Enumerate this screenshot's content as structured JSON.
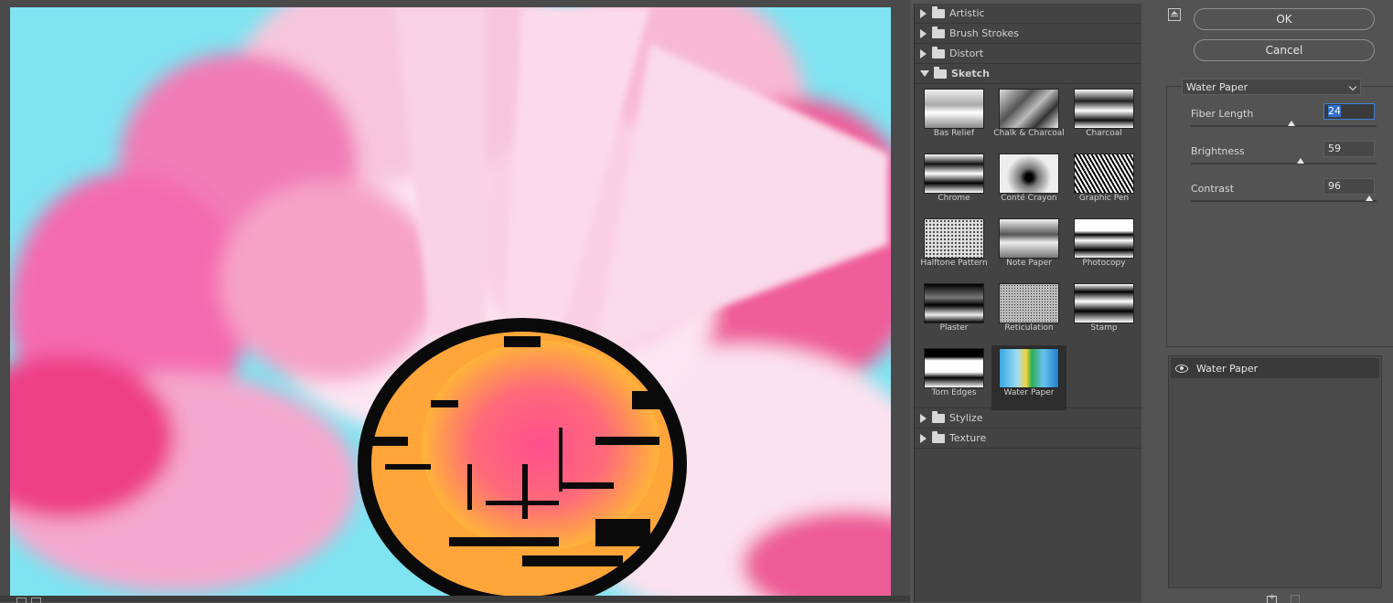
{
  "gallery": {
    "categories_top": [
      {
        "label": "Artistic",
        "expanded": false
      },
      {
        "label": "Brush Strokes",
        "expanded": false
      },
      {
        "label": "Distort",
        "expanded": false
      },
      {
        "label": "Sketch",
        "expanded": true
      }
    ],
    "sketch_filters": [
      "Bas Relief",
      "Chalk & Charcoal",
      "Charcoal",
      "Chrome",
      "Conté Crayon",
      "Graphic Pen",
      "Halftone Pattern",
      "Note Paper",
      "Photocopy",
      "Plaster",
      "Reticulation",
      "Stamp",
      "Torn Edges",
      "Water Paper"
    ],
    "selected_filter": "Water Paper",
    "categories_bottom": [
      {
        "label": "Stylize",
        "expanded": false
      },
      {
        "label": "Texture",
        "expanded": false
      }
    ]
  },
  "actions": {
    "ok_label": "OK",
    "cancel_label": "Cancel"
  },
  "settings": {
    "filter_select_value": "Water Paper",
    "params": [
      {
        "label": "Fiber Length",
        "value": "24",
        "level": 0.54
      },
      {
        "label": "Brightness",
        "value": "59",
        "level": 0.59
      },
      {
        "label": "Contrast",
        "value": "96",
        "level": 0.96
      }
    ]
  },
  "effect_layers": {
    "items": [
      {
        "label": "Water Paper",
        "visible": true
      }
    ]
  },
  "colors": {
    "accent": "#3f7ed8",
    "panel_bg": "#535353",
    "gallery_bg": "#434343"
  }
}
